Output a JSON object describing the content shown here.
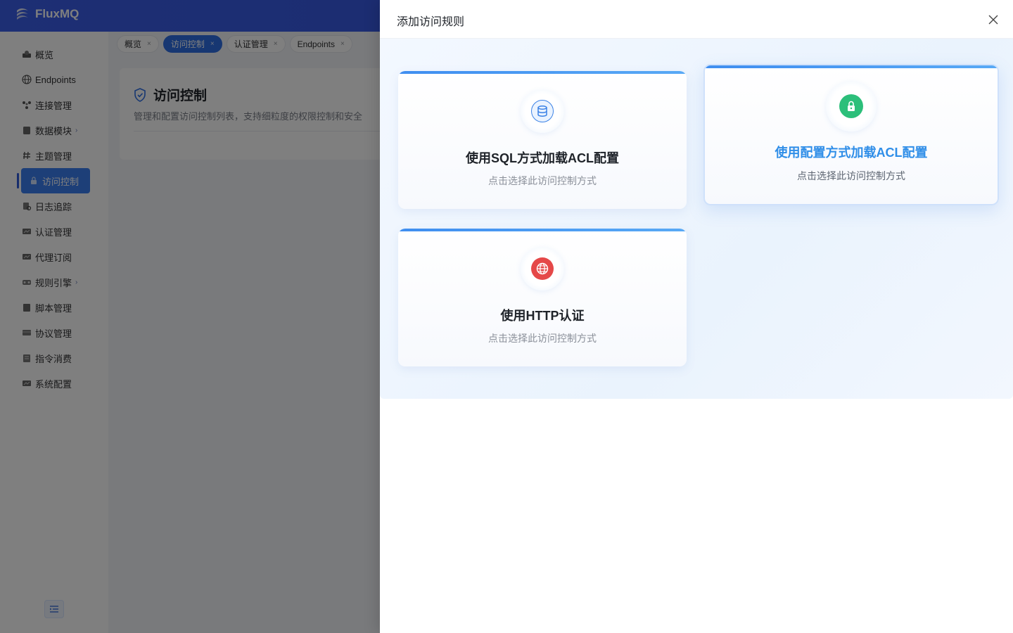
{
  "app": {
    "name": "FluxMQ"
  },
  "sidebar": {
    "items": [
      {
        "label": "概览",
        "icon": "dashboard-icon"
      },
      {
        "label": "Endpoints",
        "icon": "globe-icon"
      },
      {
        "label": "连接管理",
        "icon": "connections-icon"
      },
      {
        "label": "数据模块",
        "icon": "database-icon",
        "has_children": true
      },
      {
        "label": "主题管理",
        "icon": "hashtag-icon"
      },
      {
        "label": "访问控制",
        "icon": "lock-icon",
        "active": true
      },
      {
        "label": "日志追踪",
        "icon": "log-search-icon"
      },
      {
        "label": "认证管理",
        "icon": "auth-icon"
      },
      {
        "label": "代理订阅",
        "icon": "proxy-icon"
      },
      {
        "label": "规则引擎",
        "icon": "rules-engine-icon",
        "has_children": true
      },
      {
        "label": "脚本管理",
        "icon": "script-icon"
      },
      {
        "label": "协议管理",
        "icon": "protocol-icon"
      },
      {
        "label": "指令消费",
        "icon": "command-icon"
      },
      {
        "label": "系统配置",
        "icon": "settings-icon"
      }
    ],
    "chevron": "›"
  },
  "tabs": [
    {
      "label": "概览",
      "active": false
    },
    {
      "label": "访问控制",
      "active": true
    },
    {
      "label": "认证管理",
      "active": false
    },
    {
      "label": "Endpoints",
      "active": false
    }
  ],
  "tab_close": "×",
  "page": {
    "title": "访问控制",
    "description": "管理和配置访问控制列表，支持细粒度的权限控制和安全"
  },
  "drawer": {
    "title": "添加访问规则",
    "options": [
      {
        "title": "使用SQL方式加载ACL配置",
        "subtitle": "点击选择此访问控制方式",
        "icon": "database-icon",
        "color": "#3b82e6"
      },
      {
        "title": "使用配置方式加载ACL配置",
        "subtitle": "点击选择此访问控制方式",
        "icon": "lock-icon",
        "color": "#2cbf7a",
        "selected": true
      },
      {
        "title": "使用HTTP认证",
        "subtitle": "点击选择此访问控制方式",
        "icon": "globe-icon",
        "color": "#e54848"
      }
    ]
  },
  "colors": {
    "header": "#3b5ee8",
    "accent": "#2f8ee8",
    "active_menu": "#3b7ef0"
  }
}
